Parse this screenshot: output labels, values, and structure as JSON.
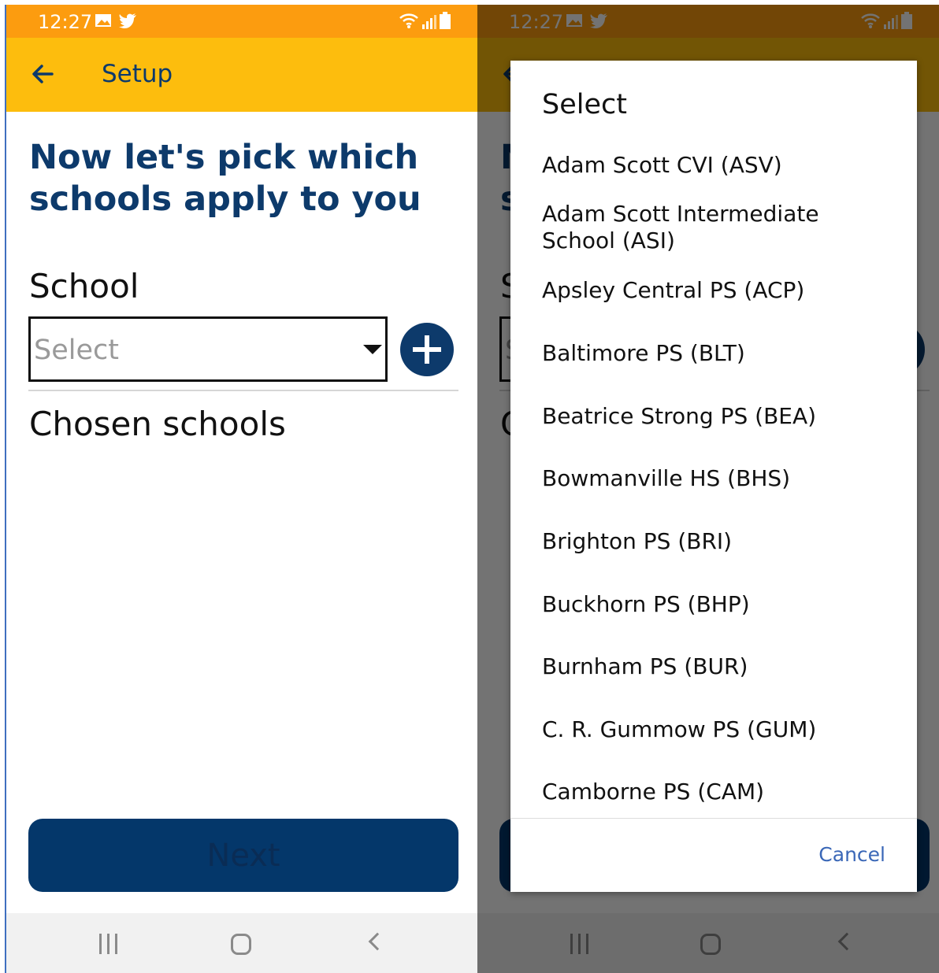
{
  "status_bar": {
    "time": "12:27",
    "colors": {
      "status": "#fc9c0f",
      "appbar": "#fdbd0d"
    }
  },
  "setup_screen": {
    "title": "Setup",
    "heading": "Now let's pick which schools apply to you",
    "school_label": "School",
    "select_placeholder": "Select",
    "chosen_label": "Chosen schools",
    "next_label": "Next",
    "colors": {
      "primary": "#0d3a6b",
      "button": "#04376a"
    }
  },
  "select_dialog": {
    "title": "Select",
    "options": [
      "Adam Scott CVI (ASV)",
      "Adam Scott Intermediate School (ASI)",
      "Apsley Central PS (ACP)",
      "Baltimore PS (BLT)",
      "Beatrice Strong PS (BEA)",
      "Bowmanville HS (BHS)",
      "Brighton PS (BRI)",
      "Buckhorn PS (BHP)",
      "Burnham PS (BUR)",
      "C. R. Gummow PS (GUM)",
      "Camborne PS (CAM)"
    ],
    "cancel_label": "Cancel",
    "colors": {
      "cancel": "#3a67b7"
    }
  },
  "nav": {
    "icons": [
      "recent-apps-icon",
      "home-icon",
      "back-icon"
    ]
  }
}
